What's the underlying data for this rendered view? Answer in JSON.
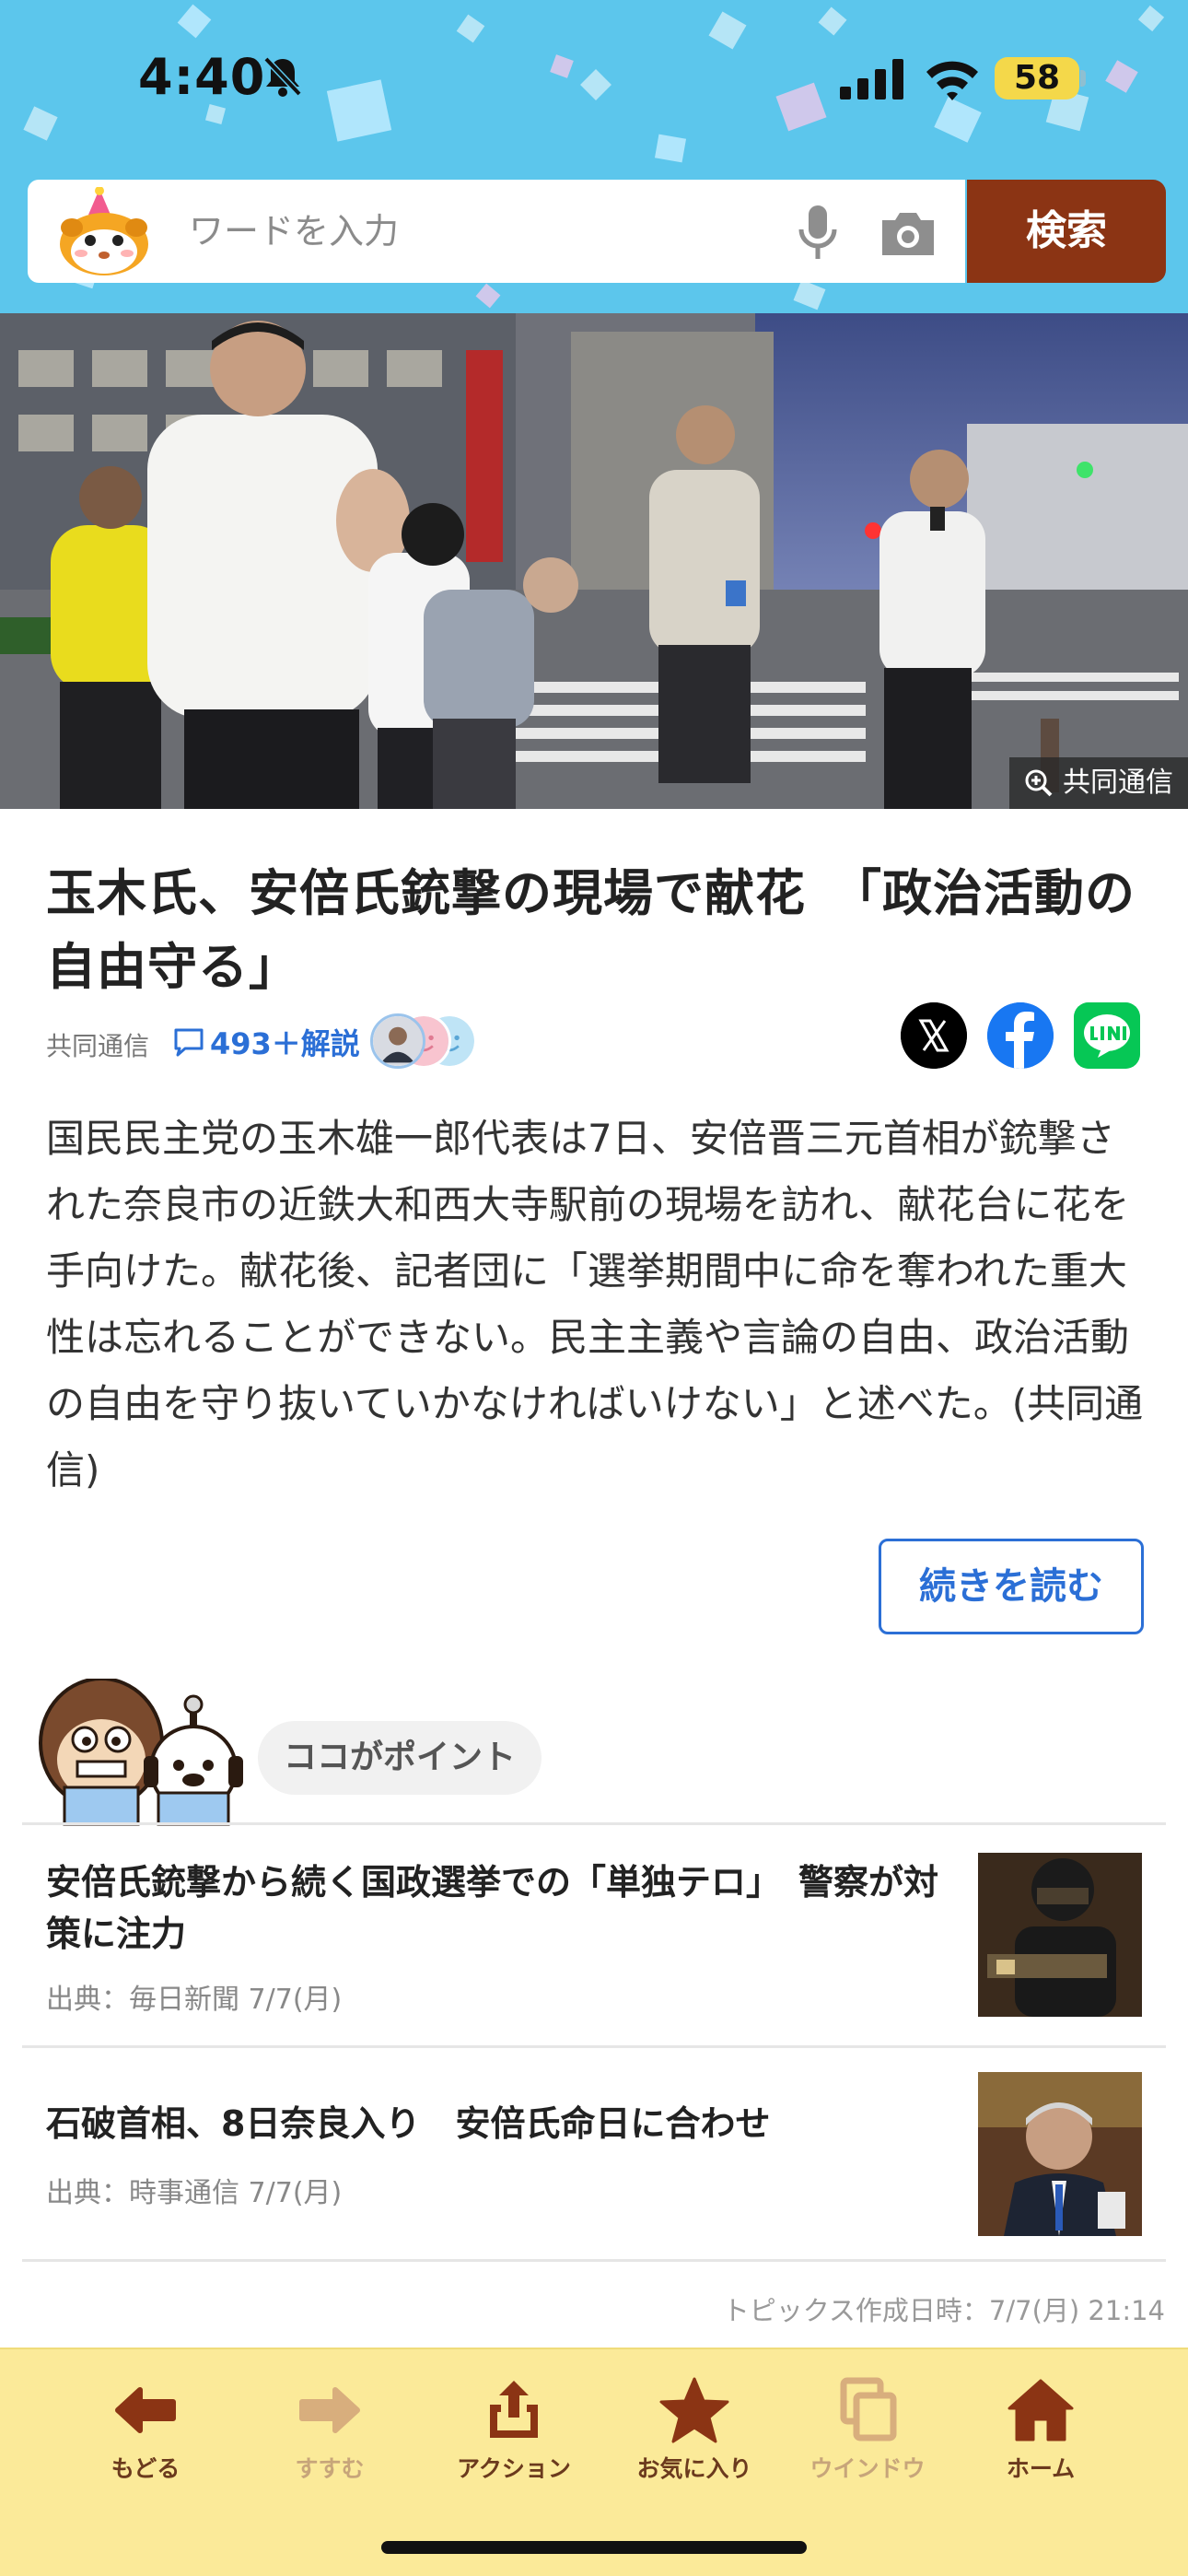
{
  "status_bar": {
    "time": "4:40",
    "battery": "58"
  },
  "search": {
    "placeholder": "ワードを入力",
    "button_label": "検索"
  },
  "hero": {
    "credit": "共同通信"
  },
  "article": {
    "title": "玉木氏、安倍氏銃撃の現場で献花　「政治活動の自由守る」",
    "source": "共同通信",
    "comments": "493＋解説",
    "body": "国民民主党の玉木雄一郎代表は7日、安倍晋三元首相が銃撃された奈良市の近鉄大和西大寺駅前の現場を訪れ、献花台に花を手向けた。献花後、記者団に「選挙期間中に命を奪われた重大性は忘れることができない。民主主義や言論の自由、政治活動の自由を守り抜いていかなければいけない」と述べた。(共同通信)",
    "read_more": "続きを読む"
  },
  "point": {
    "label": "ココがポイント",
    "items": [
      {
        "title": "安倍氏銃撃から続く国政選挙での「単独テロ」　警察が対策に注力",
        "source": "出典：毎日新聞 7/7(月)"
      },
      {
        "title": "石破首相、8日奈良入り　安倍氏命日に合わせ",
        "source": "出典：時事通信 7/7(月)"
      }
    ],
    "created_at": "トピックス作成日時：7/7(月) 21:14"
  },
  "toolbar": {
    "back": "もどる",
    "forward": "すすむ",
    "action": "アクション",
    "favorite": "お気に入り",
    "window": "ウインドウ",
    "home": "ホーム"
  },
  "colors": {
    "header_bg": "#5cc6ec",
    "search_button": "#8b3414",
    "link_blue": "#2b6fd6",
    "toolbar_bg": "#fbea99",
    "toolbar_icon": "#8b3414"
  }
}
